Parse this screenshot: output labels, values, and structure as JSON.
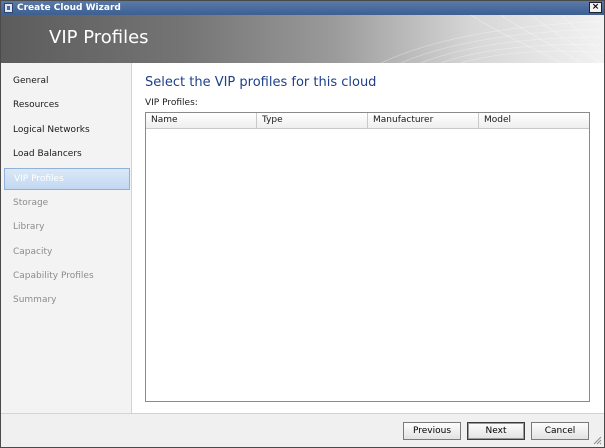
{
  "window": {
    "title": "Create Cloud Wizard"
  },
  "banner": {
    "heading": "VIP Profiles"
  },
  "sidebar": {
    "items": [
      {
        "label": "General",
        "state": "enabled"
      },
      {
        "label": "Resources",
        "state": "enabled"
      },
      {
        "label": "Logical Networks",
        "state": "enabled"
      },
      {
        "label": "Load Balancers",
        "state": "enabled"
      },
      {
        "label": "VIP Profiles",
        "state": "selected"
      },
      {
        "label": "Storage",
        "state": "disabled"
      },
      {
        "label": "Library",
        "state": "disabled"
      },
      {
        "label": "Capacity",
        "state": "disabled"
      },
      {
        "label": "Capability Profiles",
        "state": "disabled"
      },
      {
        "label": "Summary",
        "state": "disabled"
      }
    ]
  },
  "main": {
    "title": "Select the VIP profiles for this cloud",
    "list_label": "VIP Profiles:",
    "columns": [
      "Name",
      "Type",
      "Manufacturer",
      "Model"
    ]
  },
  "footer": {
    "previous_label": "Previous",
    "next_label": "Next",
    "cancel_label": "Cancel"
  },
  "colors": {
    "title_text": "#1e3f8a",
    "selection": "#c2d8f1",
    "titlebar": "#3d5f91"
  },
  "icons": [
    "app-icon",
    "close-icon",
    "resize-grip-icon"
  ]
}
